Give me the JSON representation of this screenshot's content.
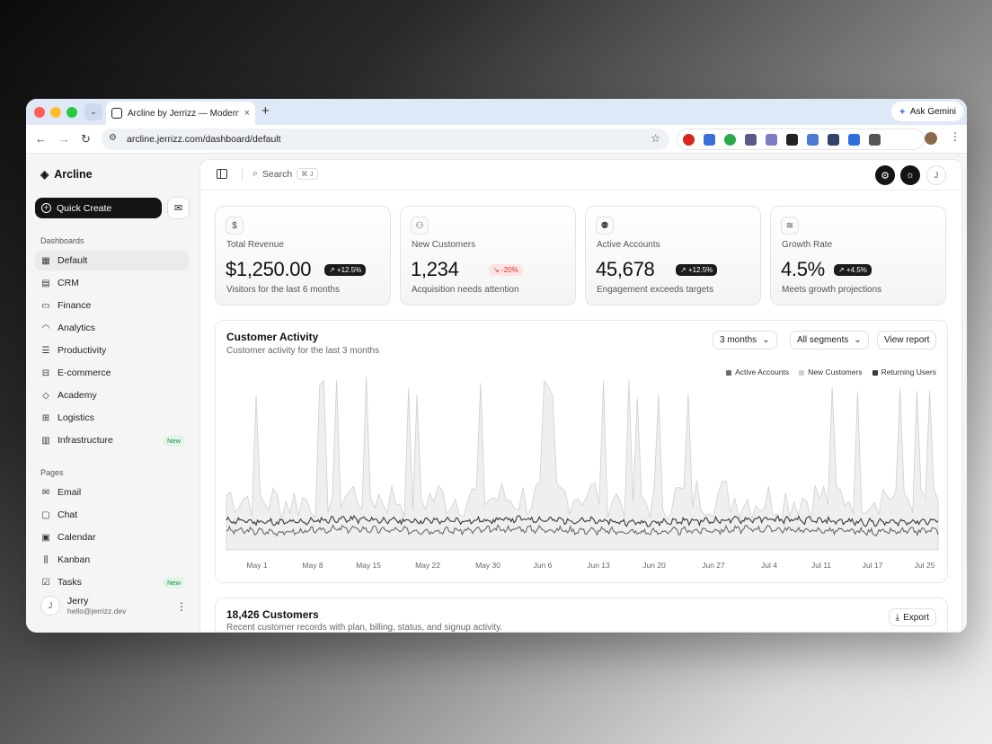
{
  "browser": {
    "tab_title": "Arcline by Jerrizz — Modern D",
    "tab_close": "×",
    "new_tab": "+",
    "tab_dropdown": "⌄",
    "ask_gemini": "Ask Gemini",
    "url": "arcline.jerrizz.com/dashboard/default",
    "traffic_colors": [
      "#ff5f57",
      "#febc2e",
      "#28c840"
    ],
    "extension_colors": [
      "#d9251d",
      "#3a6fd8",
      "#2ba84a",
      "#5a5a8a",
      "#7c7cc4",
      "#222222",
      "#4a7bd0",
      "#334466",
      "#2f6fdc",
      "#555555"
    ]
  },
  "sidebar": {
    "brand": "Arcline",
    "quick_create": "Quick Create",
    "dashboards_label": "Dashboards",
    "dashboards": [
      {
        "label": "Default",
        "icon": "layout-grid-icon",
        "glyph": "▦",
        "active": true
      },
      {
        "label": "CRM",
        "icon": "bar-chart-icon",
        "glyph": "▤"
      },
      {
        "label": "Finance",
        "icon": "banknote-icon",
        "glyph": "▭"
      },
      {
        "label": "Analytics",
        "icon": "gauge-icon",
        "glyph": "◠"
      },
      {
        "label": "Productivity",
        "icon": "list-checks-icon",
        "glyph": "☰"
      },
      {
        "label": "E-commerce",
        "icon": "shopping-bag-icon",
        "glyph": "⊟"
      },
      {
        "label": "Academy",
        "icon": "graduation-cap-icon",
        "glyph": "◇"
      },
      {
        "label": "Logistics",
        "icon": "truck-icon",
        "glyph": "⊞"
      },
      {
        "label": "Infrastructure",
        "icon": "server-icon",
        "glyph": "▥",
        "badge": "New"
      }
    ],
    "pages_label": "Pages",
    "pages": [
      {
        "label": "Email",
        "icon": "mail-icon",
        "glyph": "✉"
      },
      {
        "label": "Chat",
        "icon": "message-square-icon",
        "glyph": "▢"
      },
      {
        "label": "Calendar",
        "icon": "calendar-icon",
        "glyph": "▣"
      },
      {
        "label": "Kanban",
        "icon": "kanban-icon",
        "glyph": "⫼"
      },
      {
        "label": "Tasks",
        "icon": "square-check-icon",
        "glyph": "☑",
        "badge": "New"
      }
    ],
    "user": {
      "name": "Jerry",
      "email": "hello@jerrizz.dev",
      "initial": "J"
    }
  },
  "topbar": {
    "search": "Search",
    "shortcut": "⌘ J",
    "avatar_initial": "J"
  },
  "kpis": [
    {
      "icon": "dollar-icon",
      "glyph": "$",
      "label": "Total Revenue",
      "value": "$1,250.00",
      "badge": "↗ +12.5%",
      "negative": false,
      "sub": "Visitors for the last 6 months"
    },
    {
      "icon": "user-plus-icon",
      "glyph": "⚇",
      "label": "New Customers",
      "value": "1,234",
      "badge": "↘ -20%",
      "negative": true,
      "sub": "Acquisition needs attention"
    },
    {
      "icon": "users-icon",
      "glyph": "⚉",
      "label": "Active Accounts",
      "value": "45,678",
      "badge": "↗ +12.5%",
      "negative": false,
      "sub": "Engagement exceeds targets"
    },
    {
      "icon": "waves-icon",
      "glyph": "≋",
      "label": "Growth Rate",
      "value": "4.5%",
      "badge": "↗ +4.5%",
      "negative": false,
      "sub": "Meets growth projections"
    }
  ],
  "activity": {
    "title": "Customer Activity",
    "subtitle": "Customer activity for the last 3 months",
    "range": "3 months",
    "segments": "All segments",
    "view_report": "View report"
  },
  "chart_data": {
    "type": "area",
    "x": [
      "May 1",
      "May 8",
      "May 15",
      "May 22",
      "May 30",
      "Jun 6",
      "Jun 13",
      "Jun 20",
      "Jun 27",
      "Jul 4",
      "Jul 11",
      "Jul 17",
      "Jul 25"
    ],
    "series": [
      {
        "name": "Active Accounts",
        "color": "#6b6b6b",
        "values": [
          12,
          11,
          13,
          12,
          12,
          13,
          12,
          11,
          12,
          13,
          12,
          11,
          12
        ]
      },
      {
        "name": "New Customers",
        "color": "#d0d0d0",
        "values": [
          58,
          46,
          60,
          52,
          55,
          52,
          62,
          48,
          58,
          50,
          54,
          60,
          53
        ]
      },
      {
        "name": "Returning Users",
        "color": "#3a3a3a",
        "values": [
          18,
          17,
          19,
          18,
          18,
          19,
          18,
          17,
          18,
          19,
          18,
          17,
          18
        ]
      }
    ],
    "legend": "top-right",
    "grid": false
  },
  "customers": {
    "title": "18,426 Customers",
    "subtitle": "Recent customer records with plan, billing, status, and signup activity.",
    "export": "Export"
  }
}
